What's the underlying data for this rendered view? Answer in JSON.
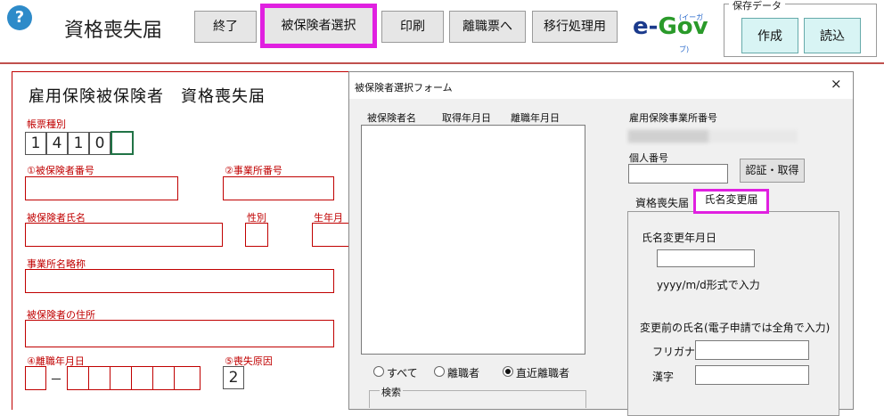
{
  "toolbar": {
    "help": "?",
    "title": "資格喪失届",
    "buttons": {
      "end": "終了",
      "select_insured": "被保険者選択",
      "print": "印刷",
      "to_separation": "離職票へ",
      "migration": "移行処理用"
    },
    "egov_text_e": "e-",
    "egov_text_gov": "Gov",
    "egov_small": "(イーガブ)",
    "save_group": {
      "title": "保存データ",
      "create": "作成",
      "load": "読込"
    }
  },
  "form": {
    "title": "雇用保険被保険者　資格喪失届",
    "form_type_label": "帳票種別",
    "form_type_digits": [
      "1",
      "4",
      "1",
      "0"
    ],
    "insured_number_label": "①被保険者番号",
    "office_number_label": "②事業所番号",
    "insured_name_label": "被保険者氏名",
    "gender_label": "性別",
    "birth_label": "生年月",
    "office_abbr_label": "事業所名略称",
    "insured_address_label": "被保険者の住所",
    "separation_date_label": "④離職年月日",
    "dash": "－",
    "loss_reason_label": "⑤喪失原因",
    "loss_reason_value": "2"
  },
  "dialog": {
    "title": "被保険者選択フォーム",
    "close": "×",
    "list_headers": [
      "被保険者名",
      "取得年月日",
      "離職年月日"
    ],
    "filter": {
      "all": "すべて",
      "separated": "離職者",
      "recent": "直近離職者"
    },
    "search_label": "検索",
    "employer_number_label": "雇用保険事業所番号",
    "personal_number_label": "個人番号",
    "auth_button": "認証・取得",
    "tabs": {
      "loss": "資格喪失届",
      "name_change": "氏名変更届"
    },
    "name_change": {
      "date_label": "氏名変更年月日",
      "date_hint": "yyyy/m/d形式で入力",
      "prev_name_label": "変更前の氏名(電子申請では全角で入力)",
      "furigana_label": "フリガナ",
      "kanji_label": "漢字"
    }
  }
}
